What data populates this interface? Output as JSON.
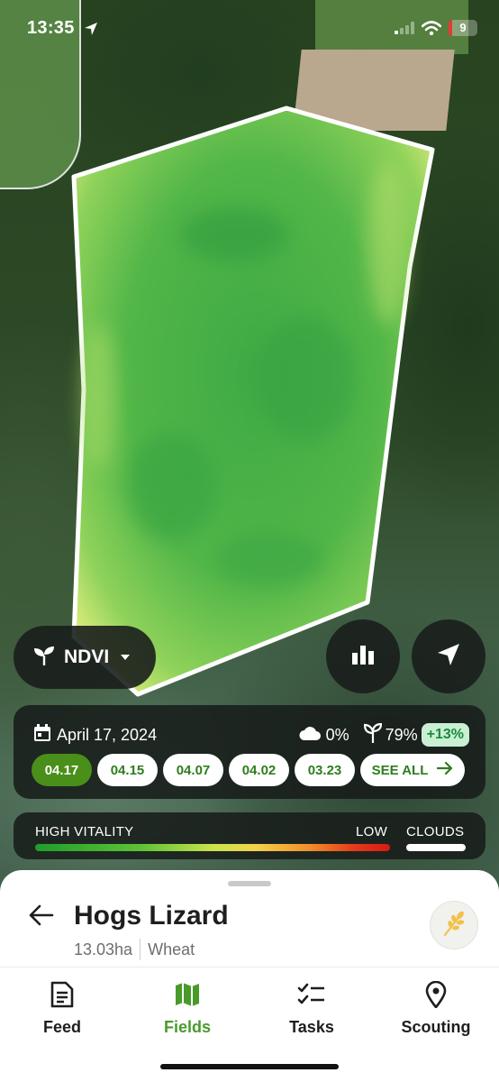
{
  "status_bar": {
    "time": "13:35",
    "battery": "9",
    "icons": [
      "location-arrow-icon",
      "cellular-signal-icon",
      "wifi-icon",
      "battery-charging-icon"
    ]
  },
  "map": {
    "layer_selector": {
      "label": "NDVI",
      "icon": "sprout-icon"
    },
    "controls": [
      "bar-chart-icon",
      "navigation-arrow-icon"
    ]
  },
  "imagery": {
    "date": "April 17, 2024",
    "cloud_cover": "0%",
    "vegetation": "79%",
    "change": "+13%",
    "dates": [
      {
        "label": "04.17",
        "active": true
      },
      {
        "label": "04.15",
        "active": false
      },
      {
        "label": "04.07",
        "active": false
      },
      {
        "label": "04.02",
        "active": false
      },
      {
        "label": "03.23",
        "active": false
      }
    ],
    "see_all": "SEE ALL"
  },
  "legend": {
    "high": "HIGH VITALITY",
    "low": "LOW",
    "clouds": "CLOUDS",
    "colors": [
      "#1f9d2a",
      "#c9e34c",
      "#f2d34b",
      "#e43a1a"
    ]
  },
  "field": {
    "name": "Hogs Lizard",
    "area": "13.03ha",
    "crop": "Wheat",
    "crop_icon": "wheat-icon"
  },
  "tabs": [
    {
      "label": "Feed",
      "icon": "feed-icon",
      "active": false
    },
    {
      "label": "Fields",
      "icon": "map-icon",
      "active": true
    },
    {
      "label": "Tasks",
      "icon": "tasks-checklist-icon",
      "active": false
    },
    {
      "label": "Scouting",
      "icon": "map-pin-icon",
      "active": false
    }
  ],
  "colors": {
    "accent": "#4a9a2a",
    "active_pill": "#4a8f1a",
    "badge_text": "#1d8a3b"
  }
}
